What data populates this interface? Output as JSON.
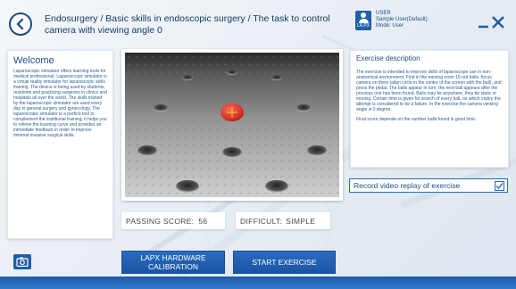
{
  "header": {
    "breadcrumb": "Endosurgery / Basic skills in endoscopic surgery / The task to control camera with viewing angle 0"
  },
  "user": {
    "tag": "LA.PX",
    "role_label": "USER",
    "name": "Sample User(Default)",
    "mode": "Mode: User"
  },
  "welcome": {
    "title": "Welcome",
    "text": "Laparoscopic simulator offers learning tools for medical professional. Laparoscopic simulator is a virtual reality simulator for laparoscopic skills training. The device is being used by students, residents and practicing surgeons in clinics and hospitals all over the world. The skills trained by the laparoscopic simulator are used every day in general surgery and gynecology. The laparoscopic simulator is a perfect tool to complement the traditional training; it helps you to relieve the learning curve and provides an immediate feedback in order to improve minimal invasive surgical skills."
  },
  "exercise": {
    "title": "Exercise description",
    "text": "The exercise is intended to improve skills of laparoscope use in non-anatomical environment. Find in the training room 10 red balls, focus camera on them (align circle in the centre of the screen with the ball), and press the pedal. The balls appear in turn; the next ball appears after the previous one has been found. Balls may be anywhere, they be static or moving. Certain time is given for search of every ball, on which expiry the attempt is considered to be a failure. In the exercise the camera viewing angle is 0 degree.",
    "score_note": "Final score depends on the number balls found in good time."
  },
  "record": {
    "label": "Record video replay of exercise",
    "checked": true
  },
  "passing": {
    "label": "PASSING SCORE:",
    "value": "56"
  },
  "difficulty": {
    "label": "DIFFICULT:",
    "value": "SIMPLE"
  },
  "buttons": {
    "calibration": "LAPX HARDWARE CALIBRATION",
    "start": "START EXERCISE"
  },
  "colors": {
    "accent": "#1e5fa8",
    "target_ball": "#e0302a",
    "crosshair": "#ffd23a"
  },
  "icons": {
    "back": "chevron-left-icon",
    "close": "close-icon",
    "camera": "camera-icon",
    "check": "checkmark-icon",
    "user": "user-icon"
  }
}
